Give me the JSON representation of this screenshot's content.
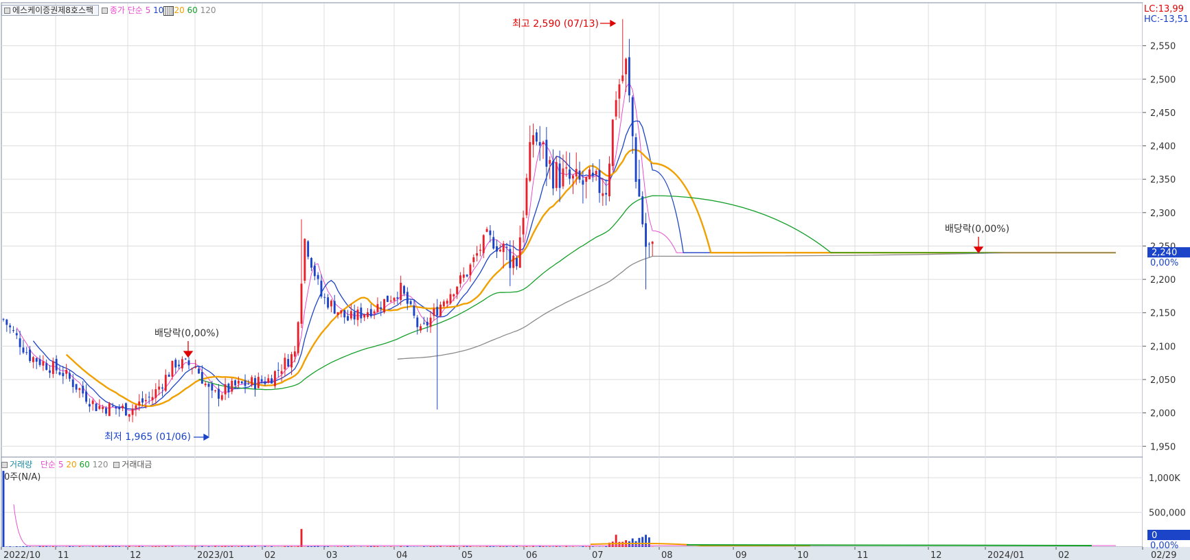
{
  "window": {
    "instrument": "에스케이증권제8호스팩",
    "price_legend": {
      "label": "종가 단순",
      "periods": [
        "5",
        "10",
        "20",
        "60",
        "120"
      ]
    },
    "volume_legend": {
      "label": "거래량",
      "ma_label": "단순",
      "periods": [
        "5",
        "20",
        "60",
        "120"
      ],
      "extra": "거래대금"
    },
    "volume_status": "0주(N/A)",
    "lc": "LC:13,99",
    "hc": "HC:-13,51"
  },
  "colors": {
    "up": "#e8202a",
    "down": "#1c44c8",
    "ma5": "#e84ccf",
    "ma10": "#1c44c8",
    "ma20": "#f0a000",
    "ma60": "#16a02a",
    "ma120": "#8a8a8a",
    "grid": "#dcdcdc"
  },
  "chart_data": [
    {
      "type": "candlestick",
      "title": "에스케이증권제8호스팩",
      "x_tick_labels": [
        "2022/10",
        "11",
        "12",
        "2023/01",
        "02",
        "03",
        "04",
        "05",
        "06",
        "07",
        "08",
        "09",
        "10",
        "11",
        "12",
        "2024/01",
        "02",
        "02/29"
      ],
      "y_ticks": [
        1950,
        2000,
        2050,
        2100,
        2150,
        2200,
        2250,
        2300,
        2350,
        2400,
        2450,
        2500,
        2550
      ],
      "y_tick_labels": [
        "1,950",
        "2,000",
        "2,050",
        "2,100",
        "2,150",
        "2,200",
        "2,250",
        "2,300",
        "2,350",
        "2,400",
        "2,450",
        "2,500",
        "2,550"
      ],
      "ylim": [
        1940,
        2600
      ],
      "series_close_keypoints": [
        {
          "t": 0,
          "close": 2140
        },
        {
          "t": 8,
          "close": 2085
        },
        {
          "t": 18,
          "close": 2060
        },
        {
          "t": 28,
          "close": 2010
        },
        {
          "t": 38,
          "close": 2005
        },
        {
          "t": 45,
          "close": 2025
        },
        {
          "t": 52,
          "close": 2075
        },
        {
          "t": 58,
          "close": 2070
        },
        {
          "t": 63,
          "close": 2025
        },
        {
          "t": 70,
          "close": 2040
        },
        {
          "t": 80,
          "close": 2050
        },
        {
          "t": 88,
          "close": 2090
        },
        {
          "t": 91,
          "close": 2260
        },
        {
          "t": 96,
          "close": 2175
        },
        {
          "t": 104,
          "close": 2140
        },
        {
          "t": 113,
          "close": 2160
        },
        {
          "t": 120,
          "close": 2185
        },
        {
          "t": 126,
          "close": 2120
        },
        {
          "t": 133,
          "close": 2170
        },
        {
          "t": 140,
          "close": 2210
        },
        {
          "t": 146,
          "close": 2265
        },
        {
          "t": 150,
          "close": 2245
        },
        {
          "t": 155,
          "close": 2230
        },
        {
          "t": 160,
          "close": 2420
        },
        {
          "t": 166,
          "close": 2360
        },
        {
          "t": 172,
          "close": 2345
        },
        {
          "t": 178,
          "close": 2340
        },
        {
          "t": 182,
          "close": 2340
        },
        {
          "t": 185,
          "close": 2480
        },
        {
          "t": 188,
          "close": 2520
        },
        {
          "t": 191,
          "close": 2360
        },
        {
          "t": 194,
          "close": 2250
        },
        {
          "t": 196,
          "close": 2240
        }
      ],
      "moving_averages": [
        {
          "name": "5",
          "color_key": "ma5"
        },
        {
          "name": "10",
          "color_key": "ma10"
        },
        {
          "name": "20",
          "color_key": "ma20"
        },
        {
          "name": "60",
          "color_key": "ma60"
        },
        {
          "name": "120",
          "color_key": "ma120"
        }
      ],
      "annotations": [
        {
          "text": "최고 2,590 (07/13)",
          "value": 2590,
          "kind": "high"
        },
        {
          "text": "최저 1,965 (01/06)",
          "value": 1965,
          "kind": "low"
        },
        {
          "text": "배당락(0,00%)",
          "kind": "ex-dividend"
        },
        {
          "text": "배당락(0,00%)",
          "kind": "ex-dividend"
        }
      ],
      "current_price": {
        "label": "2,240",
        "value": 2240
      },
      "current_change": "0,00%"
    },
    {
      "type": "bar",
      "title": "거래량",
      "y_tick_labels": [
        "500,000",
        "1,000K"
      ],
      "y_ticks": [
        500000,
        1000000
      ],
      "ylim": [
        0,
        1200000
      ],
      "current_value": "0",
      "current_change": "0,00%"
    }
  ]
}
